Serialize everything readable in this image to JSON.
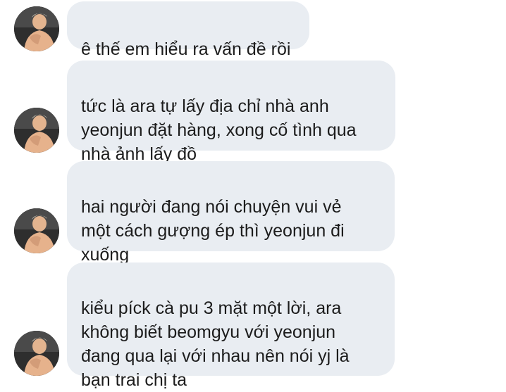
{
  "messages": [
    {
      "text": "ê thế em hiểu ra vấn đề rồi"
    },
    {
      "text": "tức là ara tự lấy địa chỉ nhà anh\nyeonjun đặt hàng, xong cố tình qua\nnhà ảnh lấy đồ"
    },
    {
      "text": "hai người đang nói chuyện vui vẻ\nmột cách gượng ép thì yeonjun đi\nxuống"
    },
    {
      "text": "kiểu píck cà pu 3 mặt một lời, ara\nkhông biết beomgyu với yeonjun\nđang qua lại với nhau nên nói yj là\nbạn trai chị ta"
    }
  ],
  "colors": {
    "bubble": "#e9edf2",
    "text": "#1c1c1c",
    "background": "#ffffff"
  },
  "icons": {
    "avatar": "profile-photo"
  }
}
